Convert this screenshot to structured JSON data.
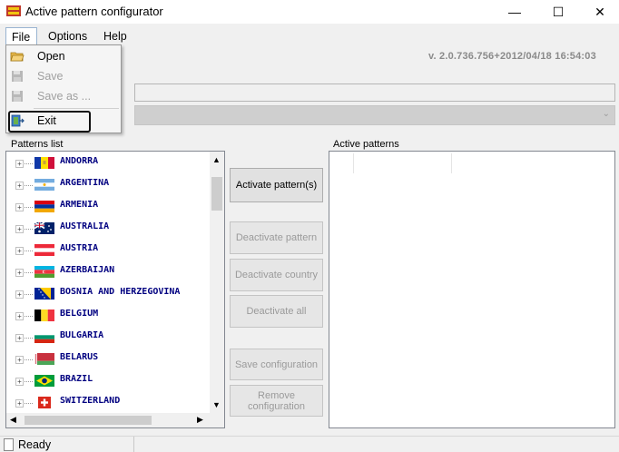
{
  "window": {
    "title": "Active pattern configurator",
    "minimize": "—",
    "maximize": "☐",
    "close": "✕"
  },
  "menu": {
    "file": "File",
    "options": "Options",
    "help": "Help"
  },
  "file_menu": [
    {
      "label": "Open",
      "icon": "folder-open-icon",
      "enabled": true
    },
    {
      "label": "Save",
      "icon": "floppy-disk-icon",
      "enabled": false
    },
    {
      "label": "Save as ...",
      "icon": "floppy-disk-icon",
      "enabled": false
    },
    {
      "label": "Exit",
      "icon": "exit-icon",
      "enabled": true
    }
  ],
  "version": "v. 2.0.736.756+2012/04/18 16:54:03",
  "patterns_list_label": "Patterns list",
  "active_patterns_label": "Active patterns",
  "countries": [
    {
      "name": "ANDORRA",
      "flag": "andorra"
    },
    {
      "name": "ARGENTINA",
      "flag": "argentina"
    },
    {
      "name": "ARMENIA",
      "flag": "armenia"
    },
    {
      "name": "AUSTRALIA",
      "flag": "australia"
    },
    {
      "name": "AUSTRIA",
      "flag": "austria"
    },
    {
      "name": "AZERBAIJAN",
      "flag": "azerbaijan"
    },
    {
      "name": "BOSNIA AND HERZEGOVINA",
      "flag": "bosnia"
    },
    {
      "name": "BELGIUM",
      "flag": "belgium"
    },
    {
      "name": "BULGARIA",
      "flag": "bulgaria"
    },
    {
      "name": "BELARUS",
      "flag": "belarus"
    },
    {
      "name": "BRAZIL",
      "flag": "brazil"
    },
    {
      "name": "SWITZERLAND",
      "flag": "switzerland"
    }
  ],
  "buttons": {
    "activate": "Activate pattern(s)",
    "deactivate_pattern": "Deactivate pattern",
    "deactivate_country": "Deactivate country",
    "deactivate_all": "Deactivate all",
    "save_configuration": "Save configuration",
    "remove_configuration": "Remove configuration"
  },
  "status": "Ready"
}
